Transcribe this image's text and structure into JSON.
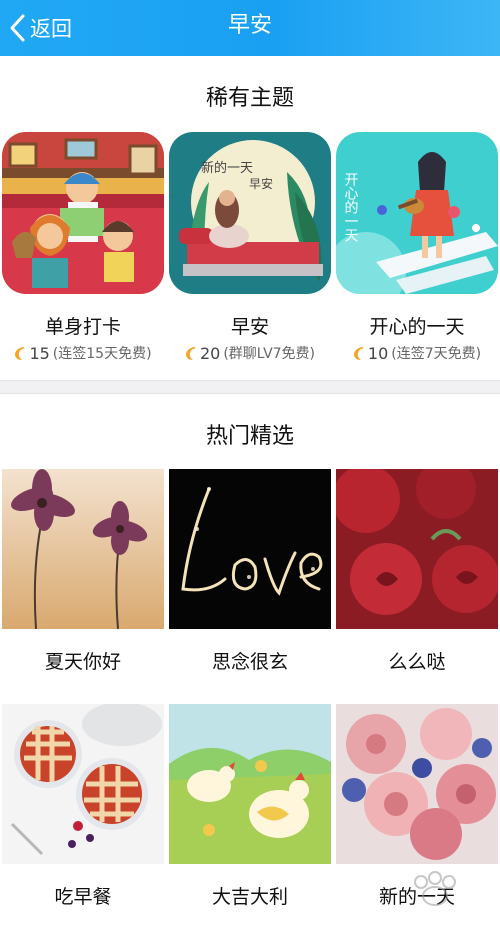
{
  "header": {
    "back_label": "返回",
    "title": "早安",
    "background_color": "#1aa0f2"
  },
  "rare_themes": {
    "title": "稀有主题",
    "items": [
      {
        "name": "单身打卡",
        "price": "15",
        "condition": "(连签15天免费)"
      },
      {
        "name": "早安",
        "price": "20",
        "condition": "(群聊LV7免费)",
        "art_text_top": "新的一天",
        "art_text_bottom": "早安"
      },
      {
        "name": "开心的一天",
        "price": "10",
        "condition": "(连签7天免费)",
        "art_text": "开心的一天"
      }
    ]
  },
  "hot_picks": {
    "title": "热门精选",
    "items": [
      {
        "name": "夏天你好"
      },
      {
        "name": "思念很玄"
      },
      {
        "name": "么么哒"
      },
      {
        "name": "吃早餐"
      },
      {
        "name": "大吉大利"
      },
      {
        "name": "新的一天"
      }
    ]
  },
  "colors": {
    "coin": "#f5a623",
    "divider": "#f1f1f3"
  }
}
